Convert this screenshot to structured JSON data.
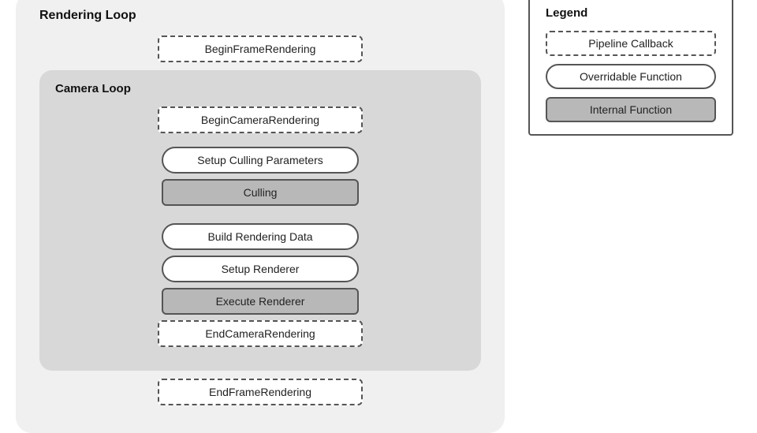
{
  "renderingLoop": {
    "title": "Rendering Loop",
    "beginFrame": "BeginFrameRendering",
    "endFrame": "EndFrameRendering",
    "cameraLoop": {
      "title": "Camera Loop",
      "items": [
        {
          "label": "BeginCameraRendering",
          "type": "pipeline"
        },
        {
          "label": "Setup Culling Parameters",
          "type": "overridable"
        },
        {
          "label": "Culling",
          "type": "internal"
        },
        {
          "label": "Build Rendering Data",
          "type": "overridable"
        },
        {
          "label": "Setup Renderer",
          "type": "overridable"
        },
        {
          "label": "Execute Renderer",
          "type": "internal"
        },
        {
          "label": "EndCameraRendering",
          "type": "pipeline"
        }
      ]
    }
  },
  "legend": {
    "title": "Legend",
    "items": [
      {
        "label": "Pipeline Callback",
        "type": "pipeline"
      },
      {
        "label": "Overridable Function",
        "type": "overridable"
      },
      {
        "label": "Internal Function",
        "type": "internal"
      }
    ]
  }
}
